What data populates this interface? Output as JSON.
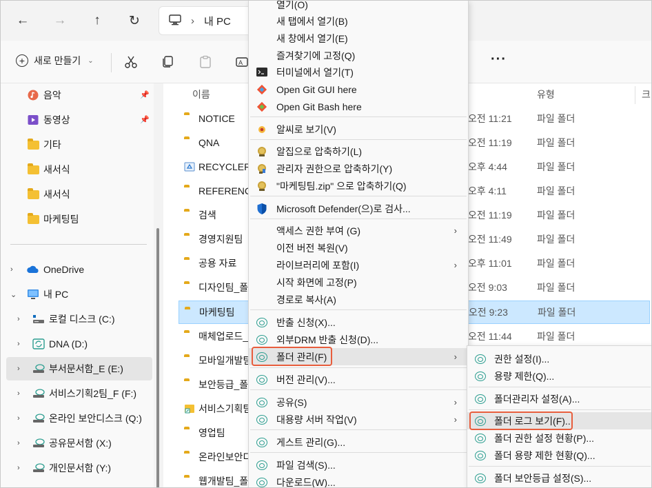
{
  "nav": {
    "address_crumb": "내 PC"
  },
  "toolbar": {
    "new_label": "새로 만들기",
    "more_label": "···"
  },
  "sidebar": {
    "items": [
      {
        "label": "음악",
        "icon": "music-icon"
      },
      {
        "label": "동영상",
        "icon": "video-icon"
      },
      {
        "label": "기타",
        "icon": "folder-icon"
      },
      {
        "label": "새서식",
        "icon": "folder-icon"
      },
      {
        "label": "새서식",
        "icon": "folder-icon"
      },
      {
        "label": "마케팅팀",
        "icon": "folder-icon"
      },
      {
        "label": "OneDrive",
        "icon": "onedrive-icon"
      },
      {
        "label": "내 PC",
        "icon": "pc-icon"
      },
      {
        "label": "로컬 디스크 (C:)",
        "icon": "drive-icon"
      },
      {
        "label": "DNA (D:)",
        "icon": "sync-drive-icon"
      },
      {
        "label": "부서문서함_E (E:)",
        "icon": "network-drive-icon"
      },
      {
        "label": "서비스기획2팀_F (F:)",
        "icon": "network-drive-icon"
      },
      {
        "label": "온라인 보안디스크 (Q:)",
        "icon": "network-drive-icon"
      },
      {
        "label": "공유문서함 (X:)",
        "icon": "network-drive-icon"
      },
      {
        "label": "개인문서함 (Y:)",
        "icon": "network-drive-icon"
      }
    ]
  },
  "filelist": {
    "headers": {
      "name": "이름",
      "type": "유형",
      "extra": "크"
    },
    "rows": [
      {
        "name": "NOTICE",
        "date": "오전 11:21",
        "type": "파일 폴더",
        "icon": "folder-icon"
      },
      {
        "name": "QNA",
        "date": "오전 11:19",
        "type": "파일 폴더",
        "icon": "folder-icon"
      },
      {
        "name": "RECYCLER",
        "date": "오후 4:44",
        "type": "파일 폴더",
        "icon": "recycle-folder-icon"
      },
      {
        "name": "REFERENCE",
        "date": "오후 4:11",
        "type": "파일 폴더",
        "icon": "folder-icon"
      },
      {
        "name": "검색",
        "date": "오전 11:19",
        "type": "파일 폴더",
        "icon": "folder-icon"
      },
      {
        "name": "경영지원팀",
        "date": "오전 11:49",
        "type": "파일 폴더",
        "icon": "folder-icon"
      },
      {
        "name": "공용 자료",
        "date": "오후 11:01",
        "type": "파일 폴더",
        "icon": "folder-icon"
      },
      {
        "name": "디자인팀_폴",
        "date": "오전 9:03",
        "type": "파일 폴더",
        "icon": "folder-icon"
      },
      {
        "name": "마케팅팀",
        "date": "오전 9:23",
        "type": "파일 폴더",
        "icon": "folder-icon"
      },
      {
        "name": "매체업로드_",
        "date": "오전 11:44",
        "type": "파일 폴더",
        "icon": "folder-icon"
      },
      {
        "name": "모바일개발팀",
        "date": "",
        "type": "",
        "icon": "folder-icon"
      },
      {
        "name": "보안등급_폴",
        "date": "",
        "type": "",
        "icon": "folder-icon"
      },
      {
        "name": "서비스기획팀",
        "date": "",
        "type": "",
        "icon": "shortcut-folder-icon"
      },
      {
        "name": "영업팀",
        "date": "",
        "type": "",
        "icon": "folder-icon"
      },
      {
        "name": "온라인보안디",
        "date": "",
        "type": "",
        "icon": "folder-icon"
      },
      {
        "name": "웹개발팀_폴",
        "date": "",
        "type": "",
        "icon": "folder-icon"
      }
    ]
  },
  "context_menu": {
    "items": [
      {
        "label": "열기(O)",
        "icon": ""
      },
      {
        "label": "새 탭에서 열기(B)",
        "icon": ""
      },
      {
        "label": "새 창에서 열기(E)",
        "icon": ""
      },
      {
        "label": "즐겨찾기에 고정(Q)",
        "icon": ""
      },
      {
        "label": "터미널에서 열기(T)",
        "icon": "terminal-icon"
      },
      {
        "label": "Open Git GUI here",
        "icon": "git-icon"
      },
      {
        "label": "Open Git Bash here",
        "icon": "git-icon"
      },
      {
        "label": "알씨로 보기(V)",
        "icon": "alsee-icon"
      },
      {
        "label": "알집으로 압축하기(L)",
        "icon": "alzip-icon"
      },
      {
        "label": "관리자 권한으로 압축하기(Y)",
        "icon": "alzip-admin-icon"
      },
      {
        "label": "\"마케팅팀.zip\" 으로 압축하기(Q)",
        "icon": "alzip-icon"
      },
      {
        "label": "Microsoft Defender(으)로 검사...",
        "icon": "defender-shield-icon"
      },
      {
        "label": "액세스 권한 부여 (G)",
        "icon": "",
        "submenu": true
      },
      {
        "label": "이전 버전 복원(V)",
        "icon": ""
      },
      {
        "label": "라이브러리에 포함(I)",
        "icon": "",
        "submenu": true
      },
      {
        "label": "시작 화면에 고정(P)",
        "icon": ""
      },
      {
        "label": "경로로 복사(A)",
        "icon": ""
      },
      {
        "label": "반출 신청(X)...",
        "icon": "dlp-icon"
      },
      {
        "label": "외부DRM 반출 신청(D)...",
        "icon": "dlp-icon"
      },
      {
        "label": "폴더 관리(F)",
        "icon": "dlp-icon",
        "submenu": true
      },
      {
        "label": "버전 관리(V)...",
        "icon": "dlp-icon"
      },
      {
        "label": "공유(S)",
        "icon": "dlp-icon",
        "submenu": true
      },
      {
        "label": "대용량 서버 작업(V)",
        "icon": "dlp-icon",
        "submenu": true
      },
      {
        "label": "게스트 관리(G)...",
        "icon": "dlp-icon"
      },
      {
        "label": "파일 검색(S)...",
        "icon": "dlp-icon"
      },
      {
        "label": "다운로드(W)...",
        "icon": "dlp-icon"
      }
    ]
  },
  "submenu": {
    "items": [
      {
        "label": "권한 설정(I)...",
        "icon": "dlp-icon"
      },
      {
        "label": "용량 제한(Q)...",
        "icon": "dlp-icon"
      },
      {
        "label": "폴더관리자 설정(A)...",
        "icon": "dlp-icon"
      },
      {
        "label": "폴더 로그 보기(F)...",
        "icon": "dlp-icon"
      },
      {
        "label": "폴더 권한 설정 현황(P)...",
        "icon": "dlp-icon"
      },
      {
        "label": "폴더 용량 제한 현황(Q)...",
        "icon": "dlp-icon"
      },
      {
        "label": "폴더 보안등급 설정(S)...",
        "icon": "dlp-icon"
      }
    ]
  },
  "colors": {
    "accent_highlight": "#e85d3c",
    "selection": "#cce8ff",
    "folder": "#f4c033"
  }
}
